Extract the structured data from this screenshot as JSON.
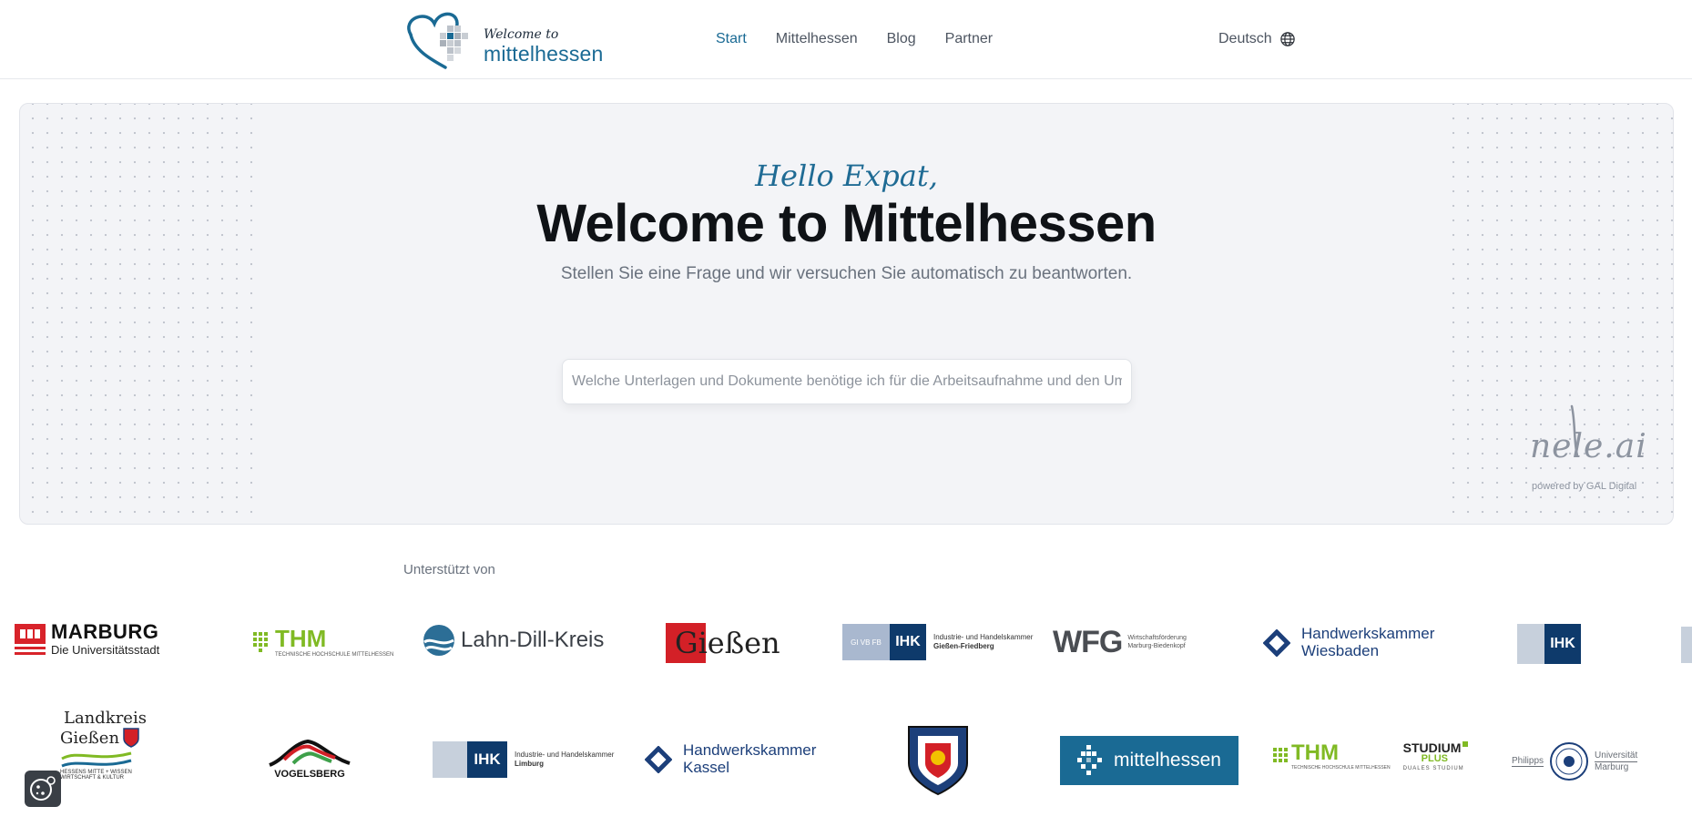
{
  "header": {
    "logo_small": "Welcome to",
    "logo_big": "mittelhessen",
    "nav": [
      {
        "label": "Start",
        "active": true
      },
      {
        "label": "Mittelhessen",
        "active": false
      },
      {
        "label": "Blog",
        "active": false
      },
      {
        "label": "Partner",
        "active": false
      }
    ],
    "language": "Deutsch",
    "language_icon": "globe-icon"
  },
  "hero": {
    "hello": "Hello Expat,",
    "title": "Welcome to Mittelhessen",
    "subtitle": "Stellen Sie eine Frage und wir versuchen Sie automatisch zu beantworten.",
    "search_placeholder": "Welche Unterlagen und Dokumente benötige ich für die Arbeitsaufnahme und den Umzu",
    "nele_logo": "nele.ai",
    "nele_sub": "powered by GAL Digital"
  },
  "supporters": {
    "label": "Unterstützt von",
    "row1": {
      "marburg": [
        "MARBURG",
        "Die Universitätsstadt"
      ],
      "thm": [
        "THM",
        "TECHNISCHE HOCHSCHULE MITTELHESSEN"
      ],
      "ldk": "Lahn-Dill-Kreis",
      "giessen": "Gießen",
      "ihk_gf": [
        "IHK",
        "Industrie- und Handelskammer",
        "Gießen-Friedberg"
      ],
      "wfg": [
        "WFG",
        "Wirtschaftsförderung",
        "Marburg-Biedenkopf"
      ],
      "hwk_wi": [
        "Handwerkskammer",
        "Wiesbaden"
      ],
      "ihk_small": "IHK"
    },
    "row2": {
      "lk_giessen": [
        "Landkreis",
        "Gießen",
        "HESSENS MITTE + WISSEN",
        "WIRTSCHAFT & KULTUR"
      ],
      "vogelsberg": "VOGELSBERG",
      "ihk_limburg": [
        "IHK",
        "Industrie- und Handelskammer",
        "Limburg"
      ],
      "hwk_kassel": [
        "Handwerkskammer",
        "Kassel"
      ],
      "mittelhessen": "mittelhessen",
      "thm_plus": [
        "THM",
        "TECHNISCHE HOCHSCHULE MITTELHESSEN",
        "STUDIUM",
        "PLUS",
        "DUALES STUDIUM"
      ],
      "uni_marburg": [
        "Philipps",
        "Universität",
        "Marburg"
      ]
    }
  },
  "colors": {
    "brand_blue": "#1a6a94",
    "thm_green": "#80ba24",
    "ihk_navy": "#0e3a6b",
    "mittelhessen_bg": "#1a6a94"
  }
}
